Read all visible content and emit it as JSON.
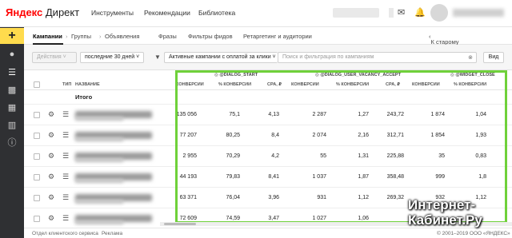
{
  "header": {
    "logo_brand": "Яндекс",
    "logo_product": "Директ",
    "nav": [
      "Инструменты",
      "Рекомендации",
      "Библиотека"
    ]
  },
  "tabs": {
    "items": [
      "Кампании",
      "Группы",
      "Объявления"
    ],
    "extra": [
      "Фразы",
      "Фильтры фидов",
      "Ретаргетинг и аудитории"
    ],
    "old_interface": "К старому интерфейсу"
  },
  "filters": {
    "actions": "Действия",
    "period": "последние 30 дней",
    "campaign_filter": "Активные кампании с оплатой за клики",
    "search_placeholder": "Поиск и фильтрация по кампаниям",
    "view": "Вид"
  },
  "table": {
    "groups": [
      "@DIALOG_START",
      "@DIALOG_USER_VACANCY_ACCEPT",
      "@WIDGET_CLOSE"
    ],
    "columns": {
      "type": "ТИП",
      "name": "НАЗВАНИЕ",
      "conv": "КОНВЕРСИИ",
      "conv_pct": "% КОНВЕРСИИ",
      "cpa": "CPA, ₽"
    },
    "total_label": "Итого",
    "rows": [
      {
        "c1": "135 056",
        "p1": "75,1",
        "a1": "4,13",
        "c2": "2 287",
        "p2": "1,27",
        "a2": "243,72",
        "c3": "1 874",
        "p3": "1,04"
      },
      {
        "c1": "77 207",
        "p1": "80,25",
        "a1": "8,4",
        "c2": "2 074",
        "p2": "2,16",
        "a2": "312,71",
        "c3": "1 854",
        "p3": "1,93"
      },
      {
        "c1": "2 955",
        "p1": "70,29",
        "a1": "4,2",
        "c2": "55",
        "p2": "1,31",
        "a2": "225,88",
        "c3": "35",
        "p3": "0,83"
      },
      {
        "c1": "44 193",
        "p1": "79,83",
        "a1": "8,41",
        "c2": "1 037",
        "p2": "1,87",
        "a2": "358,48",
        "c3": "999",
        "p3": "1,8"
      },
      {
        "c1": "63 371",
        "p1": "76,04",
        "a1": "3,96",
        "c2": "931",
        "p2": "1,12",
        "a2": "269,32",
        "c3": "932",
        "p3": "1,12"
      },
      {
        "c1": "72 609",
        "p1": "74,59",
        "a1": "3,47",
        "c2": "1 027",
        "p2": "1,06",
        "a2": "",
        "c3": "",
        "p3": ""
      }
    ]
  },
  "footer": {
    "support": "Отдел клиентского сервиса",
    "ads": "Реклама",
    "copyright": "© 2001–2019 ООО «ЯНДЕКС»"
  },
  "watermark": "Интернет-Кабинет.Ру",
  "colors": {
    "accent_yellow": "#ffdb4d",
    "highlight_green": "#6fd13a",
    "rail": "#2f3033"
  }
}
